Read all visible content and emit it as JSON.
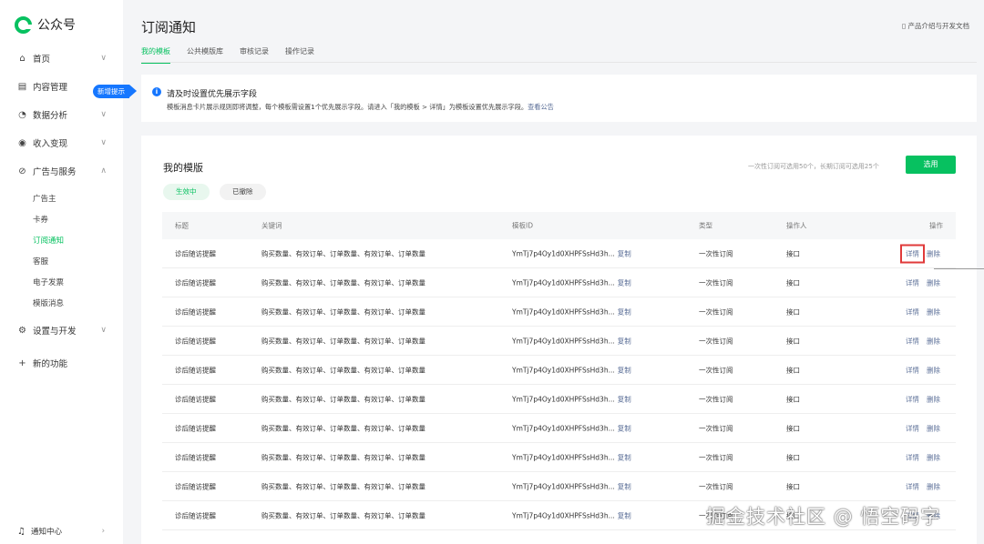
{
  "app": {
    "name": "公众号"
  },
  "sidebar": {
    "items": [
      {
        "label": "首页",
        "icon": "home-icon",
        "glyph": "⌂",
        "chevron": "∨"
      },
      {
        "label": "内容管理",
        "icon": "document-icon",
        "glyph": "▤",
        "chevron": ""
      },
      {
        "label": "数据分析",
        "icon": "chart-icon",
        "glyph": "◔",
        "chevron": "∨"
      },
      {
        "label": "收入变现",
        "icon": "money-icon",
        "glyph": "◉",
        "chevron": "∨"
      },
      {
        "label": "广告与服务",
        "icon": "ad-icon",
        "glyph": "⊘",
        "chevron": "∧"
      },
      {
        "label": "设置与开发",
        "icon": "settings-icon",
        "glyph": "⚙",
        "chevron": "∨"
      },
      {
        "label": "新的功能",
        "icon": "plus-icon",
        "glyph": "+",
        "chevron": ""
      }
    ],
    "sub_items": [
      "广告主",
      "卡券",
      "订阅通知",
      "客服",
      "电子发票",
      "模版消息"
    ],
    "new_badge": "新增提示",
    "notify": {
      "label": "通知中心",
      "chevron": "›"
    }
  },
  "header": {
    "title": "订阅通知",
    "doc_link": "产品介绍与开发文档",
    "tabs": [
      "我的模板",
      "公共模版库",
      "审核记录",
      "操作记录"
    ]
  },
  "notice": {
    "title": "请及时设置优先展示字段",
    "body": "模板消息卡片展示规则即将调整，每个模板需设置1个优先展示字段。请进入「我的模板 > 详情」为模板设置优先展示字段。",
    "link": "查看公告"
  },
  "card": {
    "title": "我的模版",
    "hint": "一次性订阅可选用50个，长期订阅可选用25个",
    "select_label": "选用",
    "filters": [
      "生效中",
      "已撤除"
    ]
  },
  "table": {
    "headers": [
      "标题",
      "关键词",
      "模板ID",
      "类型",
      "操作人",
      "操作"
    ],
    "rows": [
      {
        "title": "诊后随访提醒",
        "keywords": "购买数量、有效订单、订单数量、有效订单、订单数量",
        "id": "YmTj7p4Oy1d0XHPFSsHd3h...",
        "copy": "复制",
        "type": "一次性订阅",
        "operator": "接口",
        "detail": "详情",
        "delete": "删除"
      },
      {
        "title": "诊后随访提醒",
        "keywords": "购买数量、有效订单、订单数量、有效订单、订单数量",
        "id": "YmTj7p4Oy1d0XHPFSsHd3h...",
        "copy": "复制",
        "type": "一次性订阅",
        "operator": "接口",
        "detail": "详情",
        "delete": "删除"
      },
      {
        "title": "诊后随访提醒",
        "keywords": "购买数量、有效订单、订单数量、有效订单、订单数量",
        "id": "YmTj7p4Oy1d0XHPFSsHd3h...",
        "copy": "复制",
        "type": "一次性订阅",
        "operator": "接口",
        "detail": "详情",
        "delete": "删除"
      },
      {
        "title": "诊后随访提醒",
        "keywords": "购买数量、有效订单、订单数量、有效订单、订单数量",
        "id": "YmTj7p4Oy1d0XHPFSsHd3h...",
        "copy": "复制",
        "type": "一次性订阅",
        "operator": "接口",
        "detail": "详情",
        "delete": "删除"
      },
      {
        "title": "诊后随访提醒",
        "keywords": "购买数量、有效订单、订单数量、有效订单、订单数量",
        "id": "YmTj7p4Oy1d0XHPFSsHd3h...",
        "copy": "复制",
        "type": "一次性订阅",
        "operator": "接口",
        "detail": "详情",
        "delete": "删除"
      },
      {
        "title": "诊后随访提醒",
        "keywords": "购买数量、有效订单、订单数量、有效订单、订单数量",
        "id": "YmTj7p4Oy1d0XHPFSsHd3h...",
        "copy": "复制",
        "type": "一次性订阅",
        "operator": "接口",
        "detail": "详情",
        "delete": "删除"
      },
      {
        "title": "诊后随访提醒",
        "keywords": "购买数量、有效订单、订单数量、有效订单、订单数量",
        "id": "YmTj7p4Oy1d0XHPFSsHd3h...",
        "copy": "复制",
        "type": "一次性订阅",
        "operator": "接口",
        "detail": "详情",
        "delete": "删除"
      },
      {
        "title": "诊后随访提醒",
        "keywords": "购买数量、有效订单、订单数量、有效订单、订单数量",
        "id": "YmTj7p4Oy1d0XHPFSsHd3h...",
        "copy": "复制",
        "type": "一次性订阅",
        "operator": "接口",
        "detail": "详情",
        "delete": "删除"
      },
      {
        "title": "诊后随访提醒",
        "keywords": "购买数量、有效订单、订单数量、有效订单、订单数量",
        "id": "YmTj7p4Oy1d0XHPFSsHd3h...",
        "copy": "复制",
        "type": "一次性订阅",
        "operator": "接口",
        "detail": "详情",
        "delete": "删除"
      },
      {
        "title": "诊后随访提醒",
        "keywords": "购买数量、有效订单、订单数量、有效订单、订单数量",
        "id": "YmTj7p4Oy1d0XHPFSsHd3h...",
        "copy": "复制",
        "type": "一次性订阅",
        "operator": "接口",
        "detail": "详情",
        "delete": "删除"
      }
    ]
  },
  "watermark": "掘金技术社区 @ 悟空码字",
  "colors": {
    "accent": "#07c160",
    "link": "#576b95",
    "badge": "#1677ff",
    "highlight": "#e03a3a"
  }
}
